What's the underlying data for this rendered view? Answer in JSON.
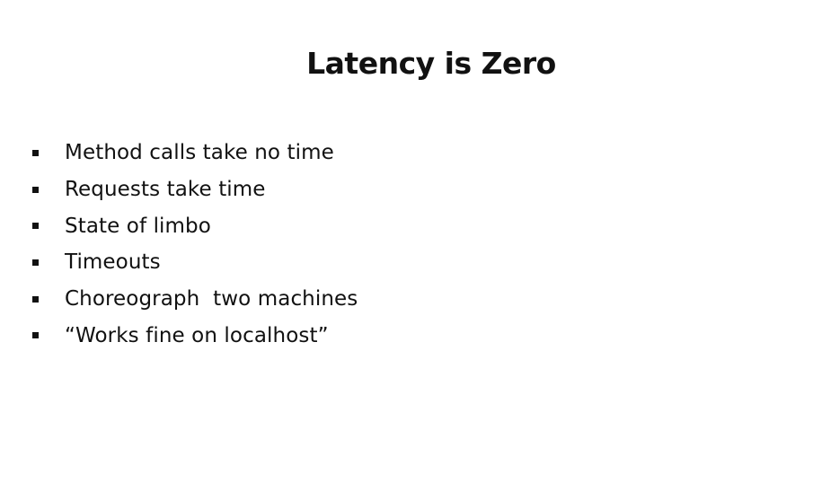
{
  "slide": {
    "title": "Latency is Zero",
    "bullets": [
      "Method calls take no time",
      "Requests take time",
      "State of limbo",
      "Timeouts",
      "Choreograph  two machines",
      "“Works fine on localhost”"
    ],
    "bullet_marker": "square"
  }
}
